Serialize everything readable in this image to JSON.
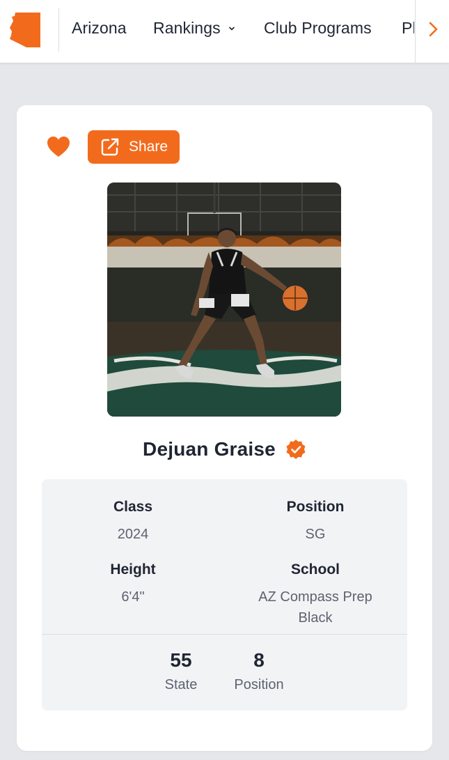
{
  "nav": {
    "logo_icon": "arizona-state-shape-icon",
    "items": [
      {
        "label": "Arizona"
      },
      {
        "label": "Rankings",
        "has_dropdown": true
      },
      {
        "label": "Club Programs"
      },
      {
        "label": "Pl"
      }
    ],
    "next_icon": "chevron-right-icon"
  },
  "profile": {
    "favorite_icon": "heart-icon",
    "share_label": "Share",
    "share_icon": "external-link-icon",
    "name": "Dejuan Graise",
    "verified_icon": "verified-badge-icon",
    "details": {
      "class_label": "Class",
      "class_value": "2024",
      "position_label": "Position",
      "position_value": "SG",
      "height_label": "Height",
      "height_value": "6'4\"",
      "school_label": "School",
      "school_value_line1": "AZ Compass Prep",
      "school_value_line2": "Black"
    },
    "rankings": {
      "state_rank": "55",
      "state_label": "State",
      "position_rank": "8",
      "position_label": "Position"
    }
  },
  "colors": {
    "accent": "#f26b1d",
    "page_bg": "#e6e7ea",
    "card_bg": "#ffffff",
    "stats_bg": "#f2f3f5",
    "text_primary": "#1f2533",
    "text_secondary": "#5c6370"
  }
}
